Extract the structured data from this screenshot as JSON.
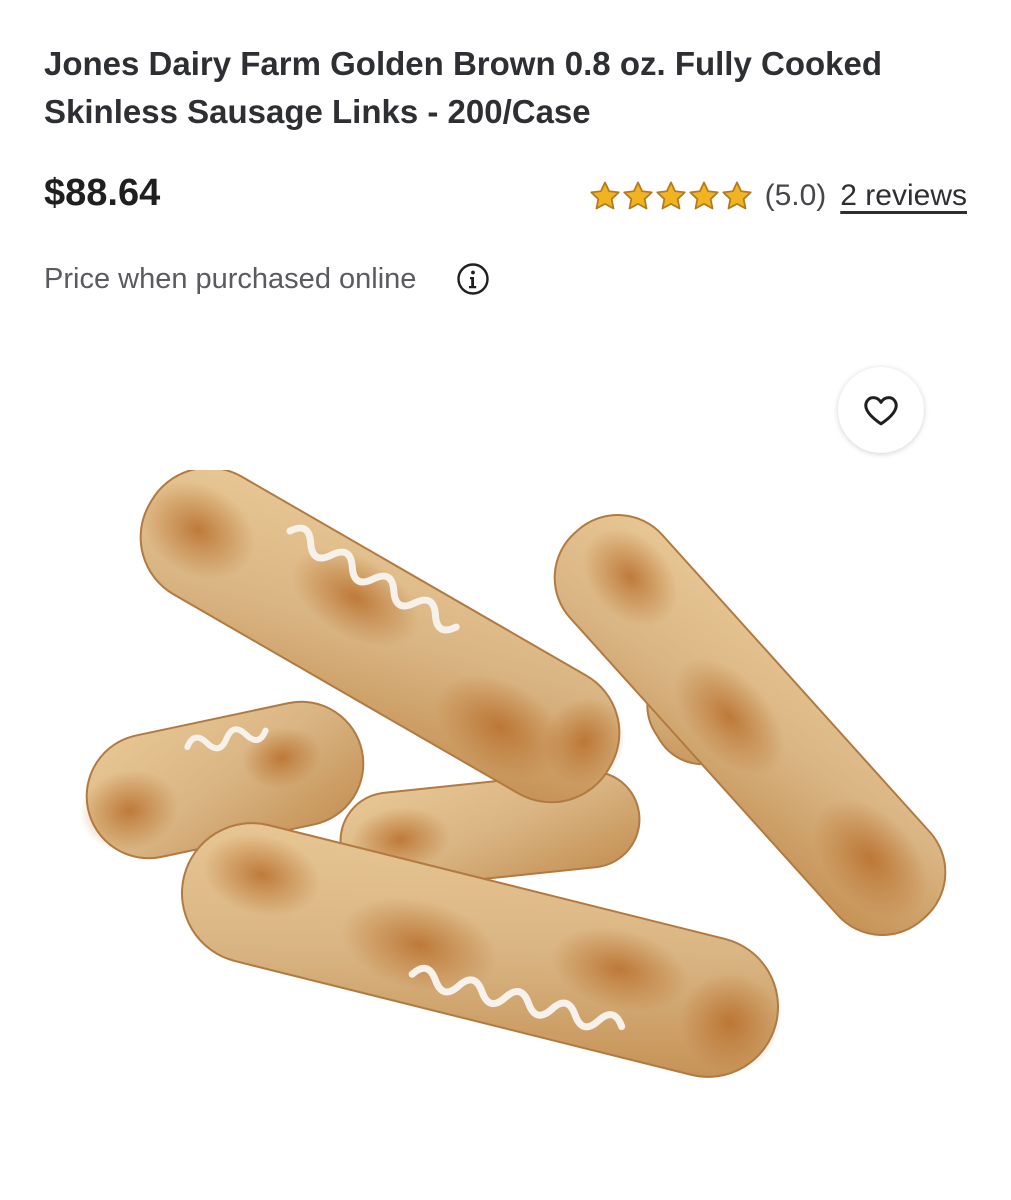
{
  "product": {
    "title": "Jones Dairy Farm Golden Brown 0.8 oz. Fully Cooked Skinless Sausage Links - 200/Case",
    "price": "$88.64",
    "price_note": "Price when purchased online",
    "rating": {
      "stars": 5,
      "max_stars": 5,
      "value_text": "(5.0)",
      "reviews_text": "2 reviews"
    },
    "image": {
      "subject": "sausage links"
    }
  },
  "icons": {
    "star": "star-icon",
    "info": "info-icon",
    "favorite": "heart-icon"
  },
  "colors": {
    "star": "#f2b323",
    "star_outline": "#b5791a",
    "text": "#2e2f32",
    "muted": "#5a5b5f"
  }
}
